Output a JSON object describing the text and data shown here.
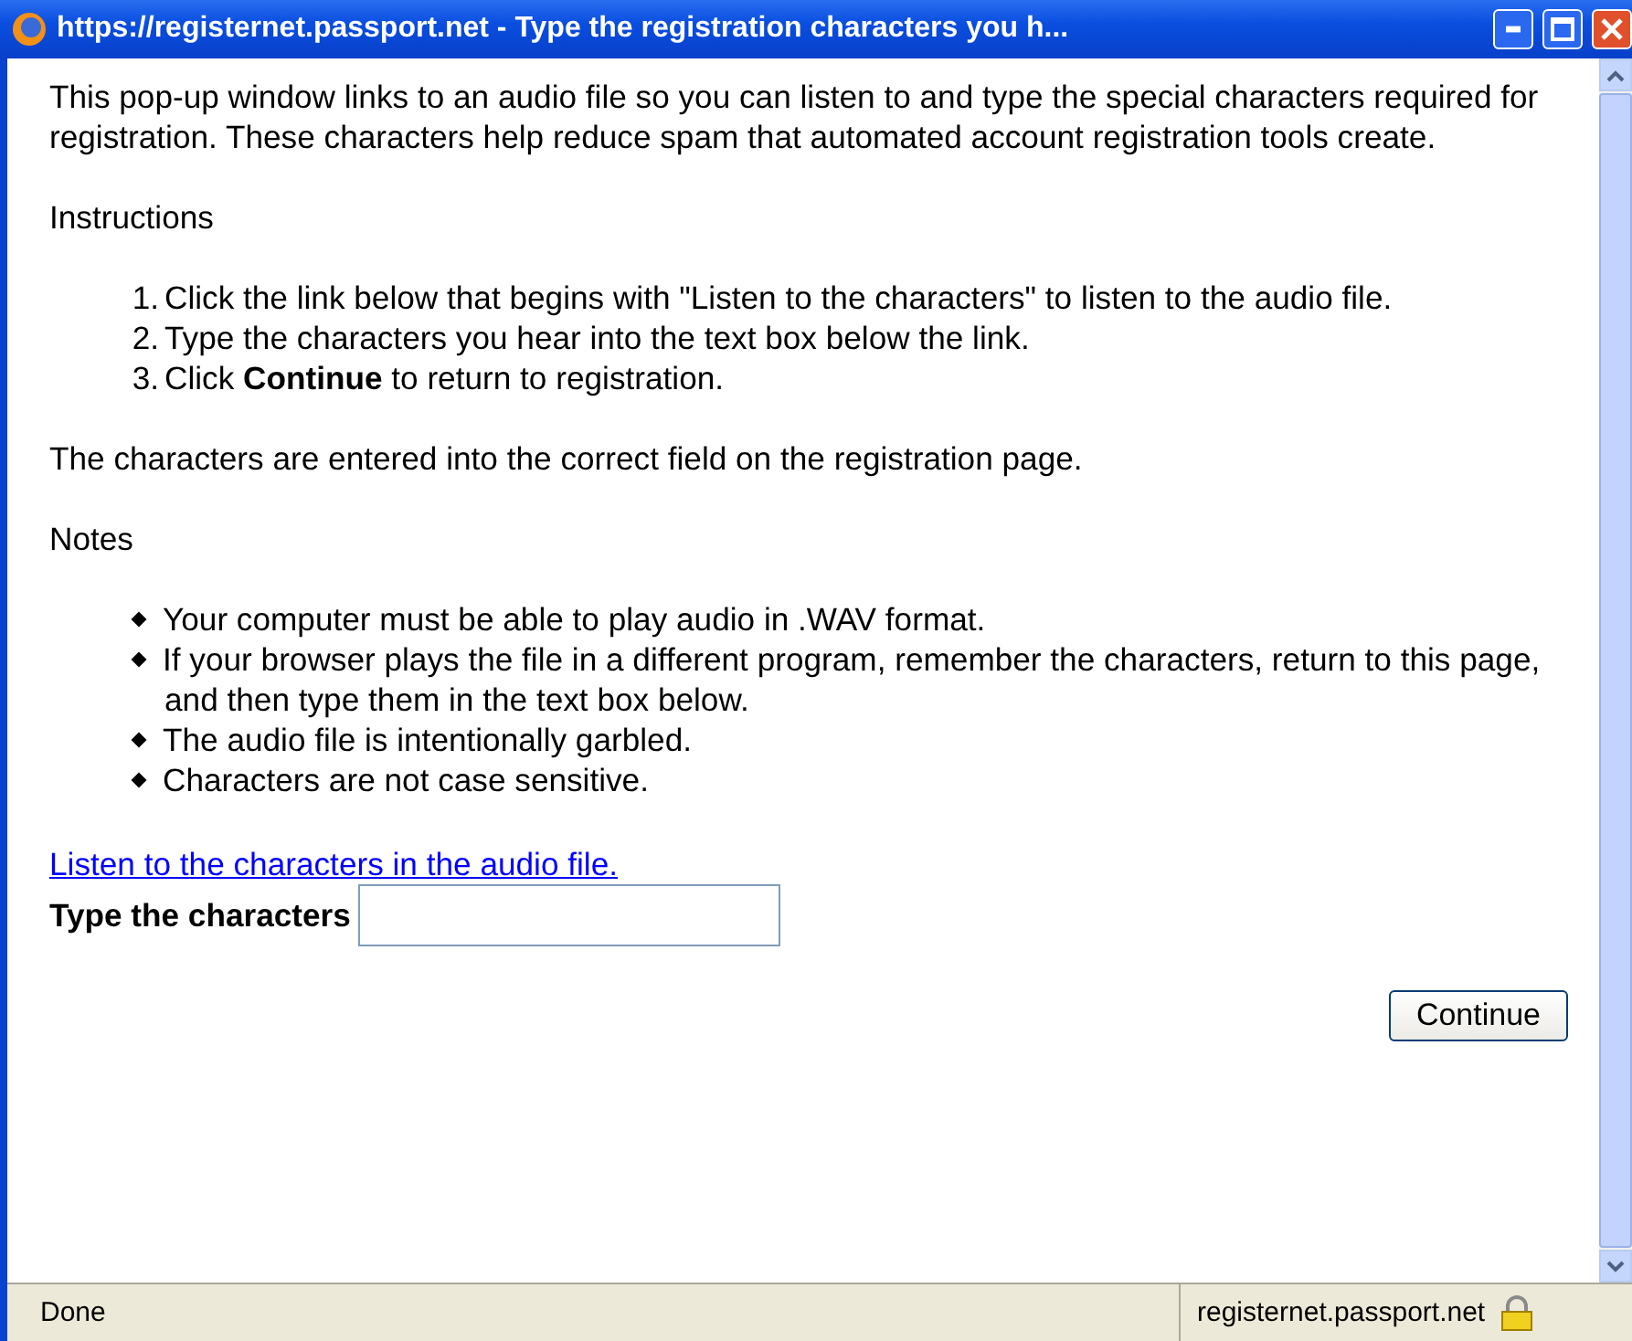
{
  "window": {
    "title": "https://registernet.passport.net - Type the registration characters you h..."
  },
  "intro": "This pop-up window links to an audio file so you can listen to and type the special characters required for registration. These characters help reduce spam that automated account registration tools create.",
  "instructions_heading": "Instructions",
  "steps": [
    {
      "marker": "1.",
      "text": "Click the link below that begins with \"Listen to the characters\" to listen to the audio file."
    },
    {
      "marker": "2.",
      "text": "Type the characters you hear into the text box below the link."
    },
    {
      "marker": "3.",
      "text": "Click **Continue** to return to registration."
    }
  ],
  "result_text": "The characters are entered into the correct field on the registration page.",
  "notes_heading": "Notes",
  "notes": [
    "Your computer must be able to play audio in .WAV format.",
    "If your browser plays the file in a different program, remember the characters, return to this page, and then type them in the text box below.",
    "The audio file is intentionally garbled.",
    "Characters are not case sensitive."
  ],
  "audio_link": "Listen to the characters in the audio file.",
  "field": {
    "label": "Type the characters"
  },
  "continue_button": "Continue",
  "status_bar": {
    "text": "Done",
    "host": "registernet.passport.net",
    "secure": true
  }
}
